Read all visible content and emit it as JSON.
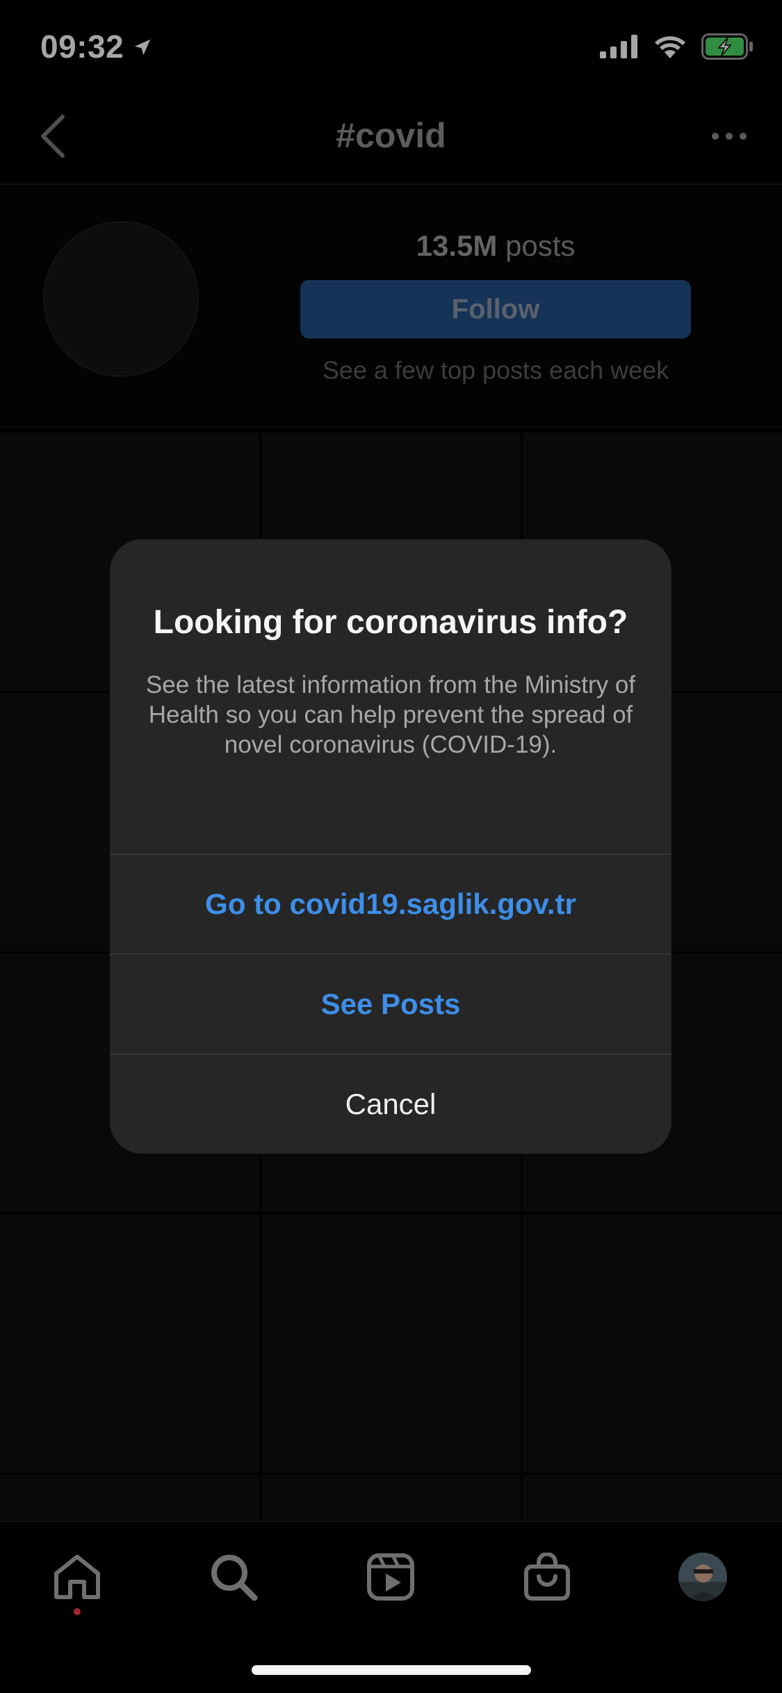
{
  "status_bar": {
    "time": "09:32",
    "icons": [
      "location-arrow-icon",
      "cellular-signal-icon",
      "wifi-icon",
      "battery-charging-icon"
    ],
    "battery_color": "#4cd964"
  },
  "header": {
    "title": "#covid",
    "back_icon": "chevron-left-icon",
    "more_icon": "more-horizontal-icon"
  },
  "hashtag": {
    "post_count": "13.5M",
    "posts_label": "posts",
    "follow_label": "Follow",
    "follow_subtitle": "See a few top posts each week"
  },
  "alert": {
    "title": "Looking for coronavirus info?",
    "message": "See the latest information from the Ministry of Health so you can help prevent the spread of novel coronavirus (COVID-19).",
    "actions": [
      {
        "label": "Go to covid19.saglik.gov.tr",
        "style": "primary"
      },
      {
        "label": "See Posts",
        "style": "primary"
      },
      {
        "label": "Cancel",
        "style": "default"
      }
    ]
  },
  "tab_bar": {
    "items": [
      {
        "name": "home",
        "icon": "home-icon",
        "active": true,
        "notification_dot": true
      },
      {
        "name": "search",
        "icon": "search-icon"
      },
      {
        "name": "reels",
        "icon": "reels-icon"
      },
      {
        "name": "shop",
        "icon": "shop-bag-icon"
      },
      {
        "name": "profile",
        "icon": "profile-avatar"
      }
    ]
  },
  "colors": {
    "accent_link": "#3d8ee8",
    "follow_button": "#214f86",
    "alert_background": "#262626",
    "notification_dot": "#a3262b"
  }
}
